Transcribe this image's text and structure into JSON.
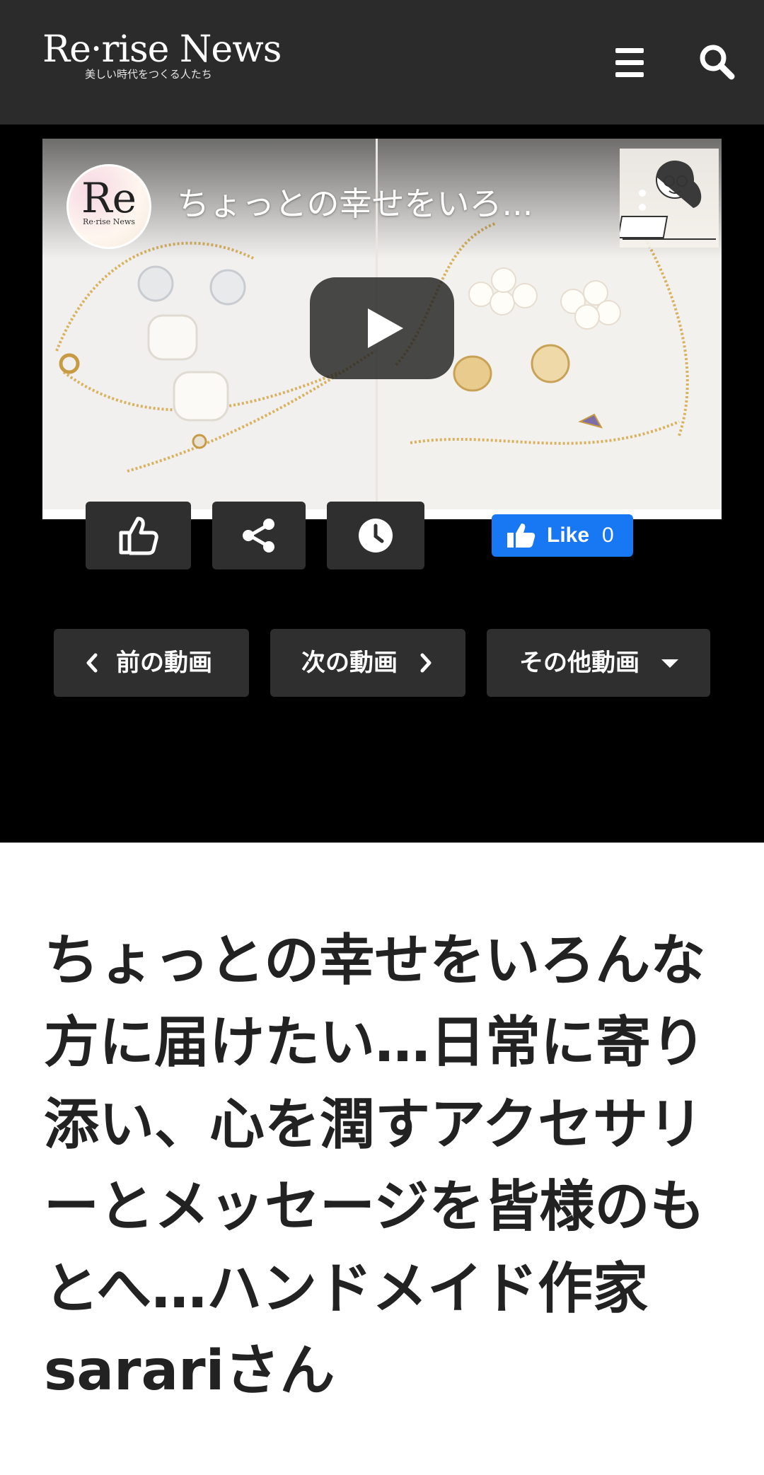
{
  "header": {
    "logo_text": "Re·rise News",
    "logo_tagline": "美しい時代をつくる人たち",
    "menu_icon": "hamburger-menu-icon",
    "search_icon": "search-icon"
  },
  "video": {
    "channel_avatar_text": "Re",
    "channel_avatar_subtext": "Re·rise News",
    "title": "ちょっとの幸せをいろ...",
    "play_icon": "play-icon",
    "more_icon": "more-vertical-icon"
  },
  "actions": {
    "like_icon": "thumbs-up-icon",
    "share_icon": "share-icon",
    "watch_later_icon": "clock-icon",
    "fb_like_label": "Like",
    "fb_like_count": "0"
  },
  "nav": {
    "prev_label": "前の動画",
    "next_label": "次の動画",
    "more_label": "その他動画"
  },
  "article": {
    "title": "ちょっとの幸せをいろんな方に届けたい…日常に寄り添い、心を潤すアクセサリーとメッセージを皆様のもとへ…ハンドメイド作家sarariさん"
  },
  "colors": {
    "header_bg": "#2b2b2b",
    "video_area_bg": "#000000",
    "button_bg": "#2f2f2f",
    "facebook_blue": "#1877f2",
    "title_text": "#222222"
  }
}
